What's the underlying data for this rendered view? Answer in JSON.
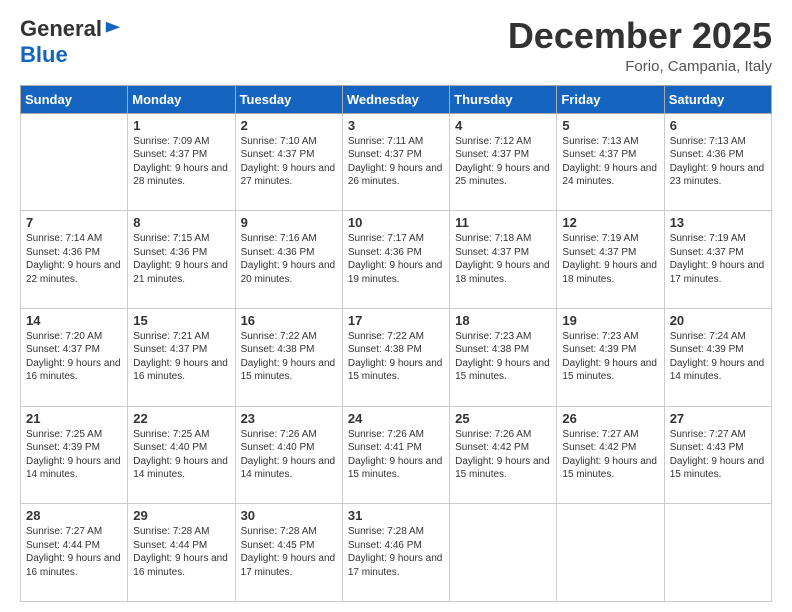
{
  "header": {
    "logo_general": "General",
    "logo_blue": "Blue",
    "month_title": "December 2025",
    "location": "Forio, Campania, Italy"
  },
  "days_of_week": [
    "Sunday",
    "Monday",
    "Tuesday",
    "Wednesday",
    "Thursday",
    "Friday",
    "Saturday"
  ],
  "weeks": [
    [
      {
        "day": "",
        "sunrise": "",
        "sunset": "",
        "daylight": "",
        "empty": true
      },
      {
        "day": "1",
        "sunrise": "Sunrise: 7:09 AM",
        "sunset": "Sunset: 4:37 PM",
        "daylight": "Daylight: 9 hours and 28 minutes."
      },
      {
        "day": "2",
        "sunrise": "Sunrise: 7:10 AM",
        "sunset": "Sunset: 4:37 PM",
        "daylight": "Daylight: 9 hours and 27 minutes."
      },
      {
        "day": "3",
        "sunrise": "Sunrise: 7:11 AM",
        "sunset": "Sunset: 4:37 PM",
        "daylight": "Daylight: 9 hours and 26 minutes."
      },
      {
        "day": "4",
        "sunrise": "Sunrise: 7:12 AM",
        "sunset": "Sunset: 4:37 PM",
        "daylight": "Daylight: 9 hours and 25 minutes."
      },
      {
        "day": "5",
        "sunrise": "Sunrise: 7:13 AM",
        "sunset": "Sunset: 4:37 PM",
        "daylight": "Daylight: 9 hours and 24 minutes."
      },
      {
        "day": "6",
        "sunrise": "Sunrise: 7:13 AM",
        "sunset": "Sunset: 4:36 PM",
        "daylight": "Daylight: 9 hours and 23 minutes."
      }
    ],
    [
      {
        "day": "7",
        "sunrise": "Sunrise: 7:14 AM",
        "sunset": "Sunset: 4:36 PM",
        "daylight": "Daylight: 9 hours and 22 minutes."
      },
      {
        "day": "8",
        "sunrise": "Sunrise: 7:15 AM",
        "sunset": "Sunset: 4:36 PM",
        "daylight": "Daylight: 9 hours and 21 minutes."
      },
      {
        "day": "9",
        "sunrise": "Sunrise: 7:16 AM",
        "sunset": "Sunset: 4:36 PM",
        "daylight": "Daylight: 9 hours and 20 minutes."
      },
      {
        "day": "10",
        "sunrise": "Sunrise: 7:17 AM",
        "sunset": "Sunset: 4:36 PM",
        "daylight": "Daylight: 9 hours and 19 minutes."
      },
      {
        "day": "11",
        "sunrise": "Sunrise: 7:18 AM",
        "sunset": "Sunset: 4:37 PM",
        "daylight": "Daylight: 9 hours and 18 minutes."
      },
      {
        "day": "12",
        "sunrise": "Sunrise: 7:19 AM",
        "sunset": "Sunset: 4:37 PM",
        "daylight": "Daylight: 9 hours and 18 minutes."
      },
      {
        "day": "13",
        "sunrise": "Sunrise: 7:19 AM",
        "sunset": "Sunset: 4:37 PM",
        "daylight": "Daylight: 9 hours and 17 minutes."
      }
    ],
    [
      {
        "day": "14",
        "sunrise": "Sunrise: 7:20 AM",
        "sunset": "Sunset: 4:37 PM",
        "daylight": "Daylight: 9 hours and 16 minutes."
      },
      {
        "day": "15",
        "sunrise": "Sunrise: 7:21 AM",
        "sunset": "Sunset: 4:37 PM",
        "daylight": "Daylight: 9 hours and 16 minutes."
      },
      {
        "day": "16",
        "sunrise": "Sunrise: 7:22 AM",
        "sunset": "Sunset: 4:38 PM",
        "daylight": "Daylight: 9 hours and 15 minutes."
      },
      {
        "day": "17",
        "sunrise": "Sunrise: 7:22 AM",
        "sunset": "Sunset: 4:38 PM",
        "daylight": "Daylight: 9 hours and 15 minutes."
      },
      {
        "day": "18",
        "sunrise": "Sunrise: 7:23 AM",
        "sunset": "Sunset: 4:38 PM",
        "daylight": "Daylight: 9 hours and 15 minutes."
      },
      {
        "day": "19",
        "sunrise": "Sunrise: 7:23 AM",
        "sunset": "Sunset: 4:39 PM",
        "daylight": "Daylight: 9 hours and 15 minutes."
      },
      {
        "day": "20",
        "sunrise": "Sunrise: 7:24 AM",
        "sunset": "Sunset: 4:39 PM",
        "daylight": "Daylight: 9 hours and 14 minutes."
      }
    ],
    [
      {
        "day": "21",
        "sunrise": "Sunrise: 7:25 AM",
        "sunset": "Sunset: 4:39 PM",
        "daylight": "Daylight: 9 hours and 14 minutes."
      },
      {
        "day": "22",
        "sunrise": "Sunrise: 7:25 AM",
        "sunset": "Sunset: 4:40 PM",
        "daylight": "Daylight: 9 hours and 14 minutes."
      },
      {
        "day": "23",
        "sunrise": "Sunrise: 7:26 AM",
        "sunset": "Sunset: 4:40 PM",
        "daylight": "Daylight: 9 hours and 14 minutes."
      },
      {
        "day": "24",
        "sunrise": "Sunrise: 7:26 AM",
        "sunset": "Sunset: 4:41 PM",
        "daylight": "Daylight: 9 hours and 15 minutes."
      },
      {
        "day": "25",
        "sunrise": "Sunrise: 7:26 AM",
        "sunset": "Sunset: 4:42 PM",
        "daylight": "Daylight: 9 hours and 15 minutes."
      },
      {
        "day": "26",
        "sunrise": "Sunrise: 7:27 AM",
        "sunset": "Sunset: 4:42 PM",
        "daylight": "Daylight: 9 hours and 15 minutes."
      },
      {
        "day": "27",
        "sunrise": "Sunrise: 7:27 AM",
        "sunset": "Sunset: 4:43 PM",
        "daylight": "Daylight: 9 hours and 15 minutes."
      }
    ],
    [
      {
        "day": "28",
        "sunrise": "Sunrise: 7:27 AM",
        "sunset": "Sunset: 4:44 PM",
        "daylight": "Daylight: 9 hours and 16 minutes."
      },
      {
        "day": "29",
        "sunrise": "Sunrise: 7:28 AM",
        "sunset": "Sunset: 4:44 PM",
        "daylight": "Daylight: 9 hours and 16 minutes."
      },
      {
        "day": "30",
        "sunrise": "Sunrise: 7:28 AM",
        "sunset": "Sunset: 4:45 PM",
        "daylight": "Daylight: 9 hours and 17 minutes."
      },
      {
        "day": "31",
        "sunrise": "Sunrise: 7:28 AM",
        "sunset": "Sunset: 4:46 PM",
        "daylight": "Daylight: 9 hours and 17 minutes."
      },
      {
        "day": "",
        "sunrise": "",
        "sunset": "",
        "daylight": "",
        "empty": true
      },
      {
        "day": "",
        "sunrise": "",
        "sunset": "",
        "daylight": "",
        "empty": true
      },
      {
        "day": "",
        "sunrise": "",
        "sunset": "",
        "daylight": "",
        "empty": true
      }
    ]
  ]
}
